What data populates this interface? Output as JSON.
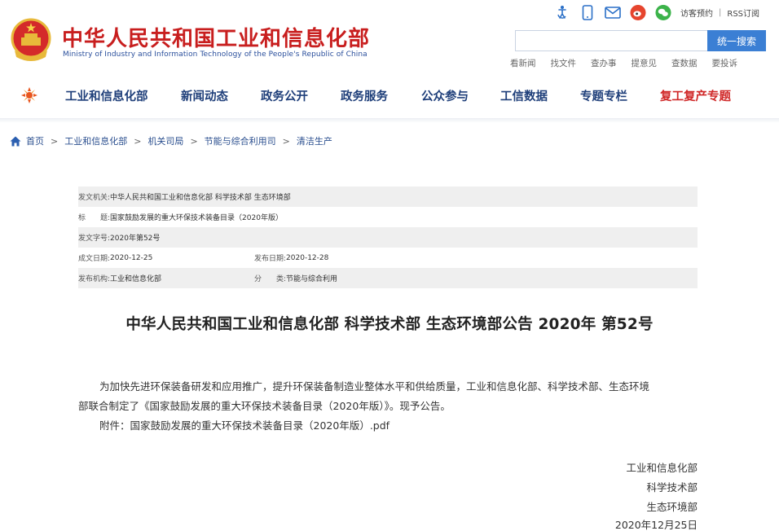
{
  "header": {
    "title_cn": "中华人民共和国工业和信息化部",
    "title_en": "Ministry of Industry and Information Technology of the People's Republic of China",
    "top_links": {
      "visitor": "访客预约",
      "separator": "|",
      "rss": "RSS订阅"
    },
    "top_icons": [
      "accessibility-icon",
      "mobile-icon",
      "mail-icon",
      "weibo-icon",
      "wechat-icon"
    ],
    "search": {
      "placeholder": "",
      "button": "统一搜索"
    },
    "quick_links": [
      "看新闻",
      "找文件",
      "查办事",
      "提意见",
      "查数据",
      "要投诉"
    ]
  },
  "nav": {
    "items": [
      {
        "label": "工业和信息化部"
      },
      {
        "label": "新闻动态"
      },
      {
        "label": "政务公开"
      },
      {
        "label": "政务服务"
      },
      {
        "label": "公众参与"
      },
      {
        "label": "工信数据"
      },
      {
        "label": "专题专栏"
      },
      {
        "label": "复工复产专题"
      }
    ]
  },
  "breadcrumb": {
    "items": [
      "首页",
      "工业和信息化部",
      "机关司局",
      "节能与综合利用司",
      "清洁生产"
    ],
    "separator": ">"
  },
  "meta": {
    "issuer_label": "发文机关:",
    "issuer": "中华人民共和国工业和信息化部 科学技术部 生态环境部",
    "title_label": "标　　题:",
    "title": "国家鼓励发展的重大环保技术装备目录（2020年版）",
    "doc_no_label": "发文字号:",
    "doc_no": "2020年第52号",
    "created_label": "成文日期:",
    "created": "2020-12-25",
    "published_label": "发布日期:",
    "published": "2020-12-28",
    "org_label": "发布机构:",
    "org": "工业和信息化部",
    "category_label": "分　　类:",
    "category": "节能与综合利用"
  },
  "article": {
    "title": "中华人民共和国工业和信息化部 科学技术部 生态环境部公告 2020年 第52号",
    "para1_line1": "为加快先进环保装备研发和应用推广，提升环保装备制造业整体水平和供给质量，工业和信息化部、科学技术部、生态环境",
    "para1_line2": "部联合制定了《国家鼓励发展的重大环保技术装备目录（2020年版）》。现予公告。",
    "attachment_label": "附件：",
    "attachment": "国家鼓励发展的重大环保技术装备目录（2020年版）.pdf",
    "signatories": [
      "工业和信息化部",
      "科学技术部",
      "生态环境部"
    ],
    "date": "2020年12月25日"
  },
  "colors": {
    "title_red": "#c81e1e",
    "nav_blue": "#1f3f7a",
    "search_button": "#3b7fd4",
    "highlight_nav": "#d02828"
  }
}
